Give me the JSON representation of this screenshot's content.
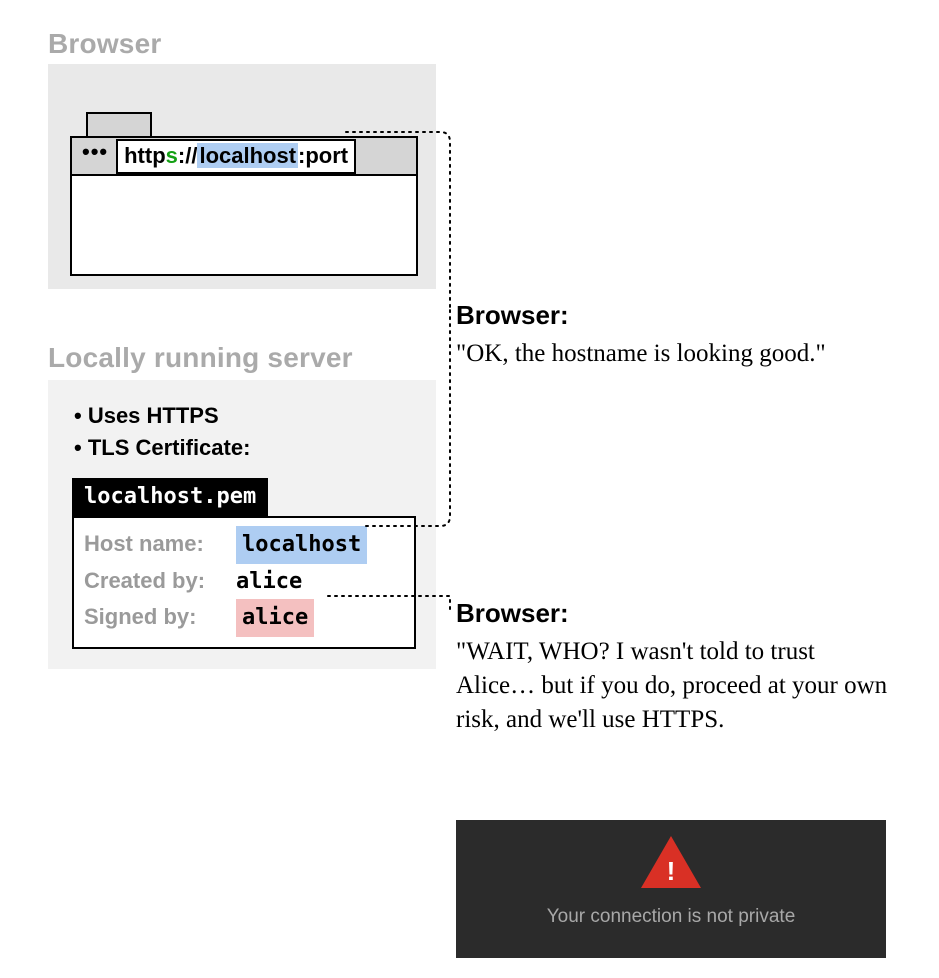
{
  "browser": {
    "panel_title": "Browser",
    "dots": "•••",
    "url": {
      "http": "http",
      "s": "s",
      "sep": "://",
      "host": "localhost",
      "tail": ":port"
    }
  },
  "server": {
    "panel_title": "Locally running server",
    "bullets": [
      "Uses HTTPS",
      "TLS Certificate:"
    ],
    "cert_filename": "localhost.pem",
    "cert": {
      "hostname_label": "Host name:",
      "hostname_value": "localhost",
      "createdby_label": "Created by:",
      "createdby_value": "alice",
      "signedby_label": "Signed by:",
      "signedby_value": "alice"
    }
  },
  "callout1": {
    "speaker": "Browser:",
    "speech": "\"OK, the hostname is looking good.\""
  },
  "callout2": {
    "speaker": "Browser:",
    "speech": "\"WAIT, WHO? I wasn't told to trust Alice… but if you do, proceed at your own risk, and we'll use HTTPS."
  },
  "warning": {
    "bang": "!",
    "text": "Your connection is not private"
  }
}
